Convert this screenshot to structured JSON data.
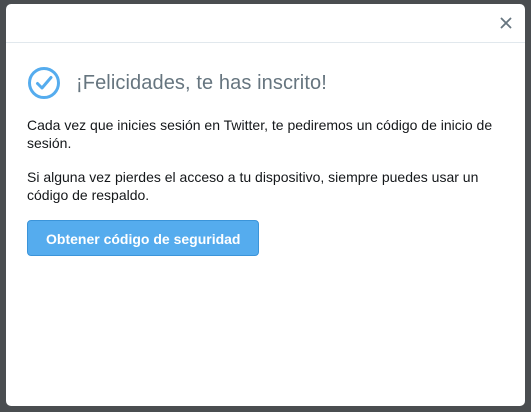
{
  "dialog": {
    "close_icon": "close-icon",
    "title": "¡Felicidades, te has inscrito!",
    "title_icon": "check-circle-icon",
    "paragraph_1": "Cada vez que inicies sesión en Twitter, te pediremos un código de inicio de sesión.",
    "paragraph_2": "Si alguna vez pierdes el acceso a tu dispositivo, siempre puedes usar un código de respaldo.",
    "primary_button_label": "Obtener código de seguridad"
  },
  "colors": {
    "accent": "#55acee",
    "title_text": "#66757f",
    "body_text": "#14171a",
    "backdrop": "#4a4d50"
  }
}
